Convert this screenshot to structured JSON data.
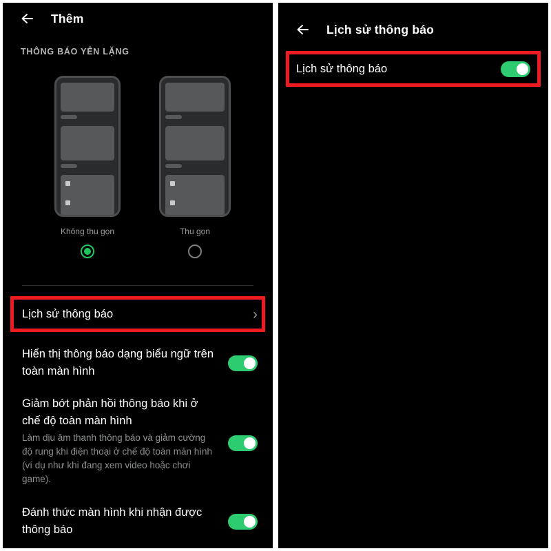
{
  "theme": {
    "background": "#000000",
    "page_background": "#ffffff",
    "accent_green": "#2ecc71",
    "radio_green": "#1fc55f",
    "annotation_red": "#ee1c20",
    "primary_text": "#ffffff",
    "secondary_text": "#8d8f90"
  },
  "left_panel": {
    "appbar": {
      "back_icon": "arrow-left-icon",
      "title": "Thêm"
    },
    "section_header": "THÔNG BÁO YÊN LẶNG",
    "previews": [
      {
        "label": "Không thu gọn",
        "selected": true
      },
      {
        "label": "Thu gọn",
        "selected": false
      }
    ],
    "rows": [
      {
        "title": "Lịch sử thông báo",
        "description": "",
        "control": "chevron",
        "chevron": "›",
        "highlighted": true
      },
      {
        "title": "Hiển thị thông báo dạng biểu ngữ trên toàn màn hình",
        "description": "",
        "control": "toggle",
        "toggle_on": true,
        "highlighted": false
      },
      {
        "title": "Giảm bớt phản hồi thông báo khi ở chế độ toàn màn hình",
        "description": "Làm dịu âm thanh thông báo và giảm cường độ rung khi điện thoại ở chế độ toàn màn hình (ví dụ như khi đang xem video hoặc chơi game).",
        "control": "toggle",
        "toggle_on": true,
        "highlighted": false
      },
      {
        "title": "Đánh thức màn hình khi nhận được thông báo",
        "description": "",
        "control": "toggle",
        "toggle_on": true,
        "highlighted": false
      }
    ]
  },
  "right_panel": {
    "appbar": {
      "back_icon": "arrow-left-icon",
      "title": "Lịch sử thông báo"
    },
    "rows": [
      {
        "title": "Lịch sử thông báo",
        "control": "toggle",
        "toggle_on": true,
        "highlighted": true
      }
    ]
  }
}
